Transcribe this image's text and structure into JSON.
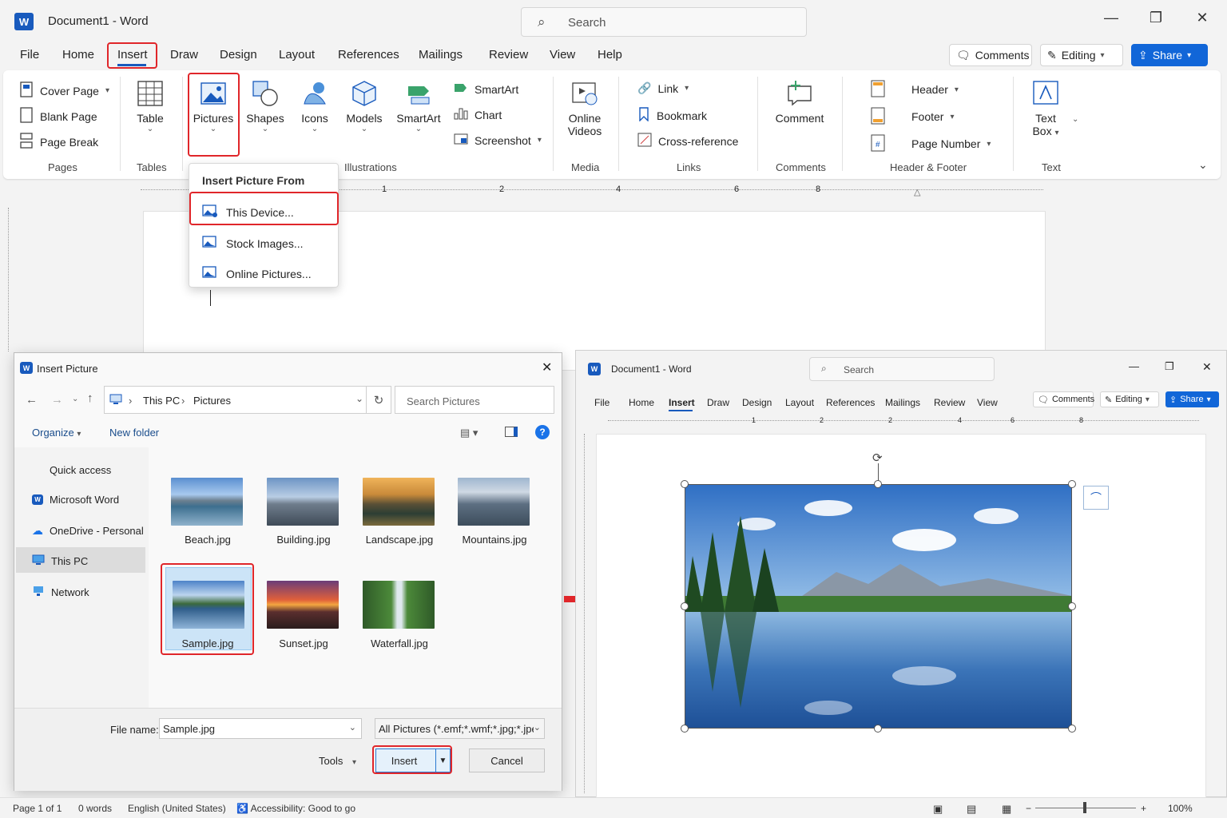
{
  "app": {
    "title": "Document1",
    "separator": "-",
    "app_name": "Word",
    "logo_letter": "W"
  },
  "search": {
    "placeholder": "Search"
  },
  "menu": {
    "tabs": [
      "File",
      "Home",
      "Insert",
      "Draw",
      "Design",
      "Layout",
      "References",
      "Mailings",
      "Review",
      "View",
      "Help"
    ],
    "active": "Insert"
  },
  "top_buttons": {
    "comments": "Comments",
    "editing": "Editing",
    "share": "Share"
  },
  "ribbon": {
    "pages": {
      "cover_page": "Cover Page",
      "blank_page": "Blank Page",
      "page_break": "Page Break",
      "group": "Pages"
    },
    "tables": {
      "table": "Table",
      "group": "Tables"
    },
    "illustrations": {
      "pictures": "Pictures",
      "shapes": "Shapes",
      "icons": "Icons",
      "models": "Models",
      "smartart_big": "SmartArt",
      "smartart": "SmartArt",
      "chart": "Chart",
      "screenshot": "Screenshot",
      "group": "Illustrations"
    },
    "media": {
      "online_videos_1": "Online",
      "online_videos_2": "Videos",
      "group": "Media"
    },
    "links": {
      "link": "Link",
      "bookmark": "Bookmark",
      "cross_reference": "Cross-reference",
      "group": "Links"
    },
    "comments": {
      "comment": "Comment",
      "group": "Comments"
    },
    "header_footer": {
      "header": "Header",
      "footer": "Footer",
      "page_number": "Page Number",
      "group": "Header & Footer"
    },
    "text": {
      "text_box_1": "Text",
      "text_box_2": "Box",
      "group": "Text"
    }
  },
  "pictures_dropdown": {
    "heading": "Insert Picture From",
    "items": [
      "This Device...",
      "Stock Images...",
      "Online Pictures..."
    ]
  },
  "ruler": {
    "marks": [
      "1",
      "2",
      "4",
      "6",
      "8"
    ]
  },
  "dialog": {
    "title": "Insert Picture",
    "breadcrumb": [
      "This PC",
      "Pictures"
    ],
    "search_placeholder": "Search Pictures",
    "organize": "Organize",
    "new_folder": "New folder",
    "nav": [
      "Quick access",
      "Microsoft Word",
      "OneDrive - Personal",
      "This PC",
      "Network"
    ],
    "files": [
      "Beach.jpg",
      "Building.jpg",
      "Landscape.jpg",
      "Mountains.jpg",
      "Sample.jpg",
      "Sunset.jpg",
      "Waterfall.jpg"
    ],
    "selected_file": "Sample.jpg",
    "file_name_label": "File name:",
    "file_name_value": "Sample.jpg",
    "file_type": "All Pictures (*.emf;*.wmf;*.jpg;*.jpe",
    "tools": "Tools",
    "insert": "Insert",
    "cancel": "Cancel"
  },
  "right_window": {
    "title": "Document1",
    "separator": "-",
    "app_name": "Word",
    "search": "Search",
    "tabs": [
      "File",
      "Home",
      "Insert",
      "Draw",
      "Design",
      "Layout",
      "References",
      "Mailings",
      "Review",
      "View"
    ],
    "comments": "Comments",
    "editing": "Editing",
    "share": "Share",
    "ruler_marks": [
      "1",
      "2",
      "2",
      "4",
      "6",
      "8"
    ]
  },
  "status": {
    "page": "Page 1 of 1",
    "words": "0 words",
    "language": "English (United States)",
    "accessibility": "Accessibility: Good to go",
    "zoom": "100%"
  },
  "colors": {
    "accent": "#1166d8",
    "highlight": "#e0262a",
    "word_blue": "#185abd"
  }
}
